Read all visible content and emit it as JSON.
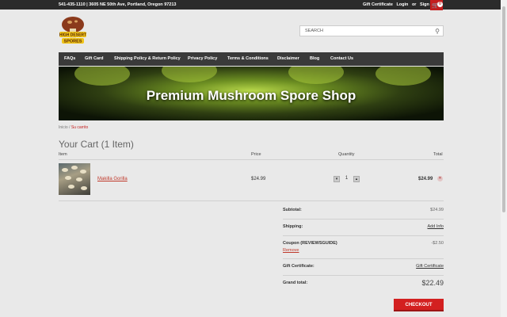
{
  "topbar": {
    "contact": "541-435-1110 | 3605 NE 50th Ave, Portland, Oregon 97213",
    "gift_certificate": "Gift Certificate",
    "login": "Login",
    "or": "or",
    "sign_up": "Sign Up",
    "cart_count": "0"
  },
  "logo": {
    "line1": "HIGH DESERT",
    "line2": "SPORES"
  },
  "search": {
    "placeholder": "SEARCH"
  },
  "nav": [
    "FAQs",
    "Gift Card",
    "Shipping Policy & Return Policy",
    "Privacy Policy",
    "Terms & Conditions",
    "Disclaimer",
    "Blog",
    "Contact Us"
  ],
  "banner": {
    "title": "Premium Mushroom Spore Shop"
  },
  "breadcrumb": {
    "home": "Inicio",
    "current": "Su carrito"
  },
  "cart": {
    "title": "Your Cart (1 Item)",
    "headers": {
      "item": "Item",
      "price": "Price",
      "quantity": "Quantity",
      "total": "Total"
    },
    "items": [
      {
        "name": "Makilla Gorilla",
        "price": "$24.99",
        "quantity": "1",
        "total": "$24.99"
      }
    ]
  },
  "summary": {
    "subtotal_label": "Subtotal:",
    "subtotal": "$24.99",
    "shipping_label": "Shipping:",
    "shipping": "Add Info",
    "coupon_label": "Coupon (REVIEWSGUIDE)",
    "coupon": "-$2.50",
    "coupon_remove": "Remove",
    "gift_label": "Gift Certificate:",
    "gift": "Gift Certificate",
    "grand_label": "Grand total:",
    "grand": "$22.49"
  },
  "checkout_label": "CHECKOUT",
  "colors": {
    "accent": "#d32020",
    "nav_bg": "#3a3a3a",
    "topbar_bg": "#2b2b2b",
    "page_bg": "#e9e9e9"
  }
}
